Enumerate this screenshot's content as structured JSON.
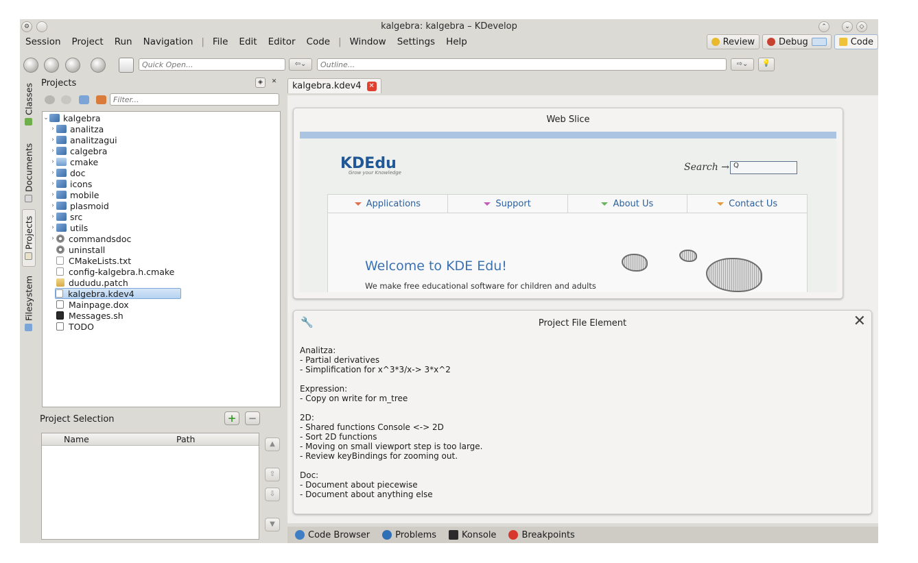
{
  "window": {
    "title": "kalgebra:  kalgebra – KDevelop"
  },
  "menubar": {
    "items": [
      "Session",
      "Project",
      "Run",
      "Navigation",
      "File",
      "Edit",
      "Editor",
      "Code",
      "Window",
      "Settings",
      "Help"
    ],
    "separator": "|"
  },
  "areas": {
    "review": "Review",
    "debug": "Debug",
    "code": "Code",
    "active": "Code"
  },
  "toolbar": {
    "quick_open_placeholder": "Quick Open...",
    "outline_placeholder": "Outline..."
  },
  "left_tabs": [
    "Classes",
    "Documents",
    "Projects",
    "Filesystem"
  ],
  "projects_panel": {
    "title": "Projects",
    "filter_placeholder": "Filter...",
    "tree": [
      {
        "label": "kalgebra",
        "type": "project",
        "expanded": true,
        "level": 0
      },
      {
        "label": "analitza",
        "type": "project",
        "level": 1
      },
      {
        "label": "analitzagui",
        "type": "project",
        "level": 1
      },
      {
        "label": "calgebra",
        "type": "project",
        "level": 1
      },
      {
        "label": "cmake",
        "type": "folder",
        "level": 1
      },
      {
        "label": "doc",
        "type": "project",
        "level": 1
      },
      {
        "label": "icons",
        "type": "project",
        "level": 1
      },
      {
        "label": "mobile",
        "type": "project",
        "level": 1
      },
      {
        "label": "plasmoid",
        "type": "project",
        "level": 1
      },
      {
        "label": "src",
        "type": "project",
        "level": 1
      },
      {
        "label": "utils",
        "type": "project",
        "level": 1
      },
      {
        "label": "commandsdoc",
        "type": "target",
        "level": 1
      },
      {
        "label": "uninstall",
        "type": "target",
        "level": 1
      },
      {
        "label": "CMakeLists.txt",
        "type": "file",
        "level": 1
      },
      {
        "label": "config-kalgebra.h.cmake",
        "type": "file",
        "level": 1
      },
      {
        "label": "dududu.patch",
        "type": "patch",
        "level": 1
      },
      {
        "label": "kalgebra.kdev4",
        "type": "file",
        "level": 1,
        "selected": true
      },
      {
        "label": "Mainpage.dox",
        "type": "dox",
        "level": 1
      },
      {
        "label": "Messages.sh",
        "type": "sh",
        "level": 1
      },
      {
        "label": "TODO",
        "type": "dox",
        "level": 1
      }
    ]
  },
  "project_selection": {
    "title": "Project Selection",
    "columns": [
      "Name",
      "Path"
    ]
  },
  "editor": {
    "tab_label": "kalgebra.kdev4"
  },
  "web_slice": {
    "title": "Web Slice",
    "logo": "KDEdu",
    "logo_tagline": "Grow your Knowledge",
    "search_label": "Search →",
    "search_value": "Q",
    "nav": [
      {
        "label": "Applications",
        "color": "#e0704d"
      },
      {
        "label": "Support",
        "color": "#c35bb8"
      },
      {
        "label": "About Us",
        "color": "#6cb35f"
      },
      {
        "label": "Contact Us",
        "color": "#e59a3a"
      }
    ],
    "welcome": "Welcome to KDE Edu!",
    "tagline": "We make free educational software for children and adults"
  },
  "note": {
    "title": "Project File Element",
    "lines": [
      "Analitza:",
      "- Partial derivatives",
      "- Simplification for x^3*3/x-> 3*x^2",
      "",
      "Expression:",
      "- Copy on write for m_tree",
      "",
      "2D:",
      "- Shared functions Console <-> 2D",
      "- Sort 2D functions",
      "- Moving on small viewport step is too large.",
      "- Review keyBindings for zooming out.",
      "",
      "Doc:",
      "- Document about piecewise",
      "- Document about anything else"
    ]
  },
  "bottom_tools": [
    {
      "label": "Code Browser",
      "icon": "code-browser-icon",
      "color": "#3f7ec2"
    },
    {
      "label": "Problems",
      "icon": "info-icon",
      "color": "#2f6fb7"
    },
    {
      "label": "Konsole",
      "icon": "terminal-icon",
      "color": "#2b2b2b"
    },
    {
      "label": "Breakpoints",
      "icon": "breakpoint-icon",
      "color": "#d8382b"
    }
  ]
}
